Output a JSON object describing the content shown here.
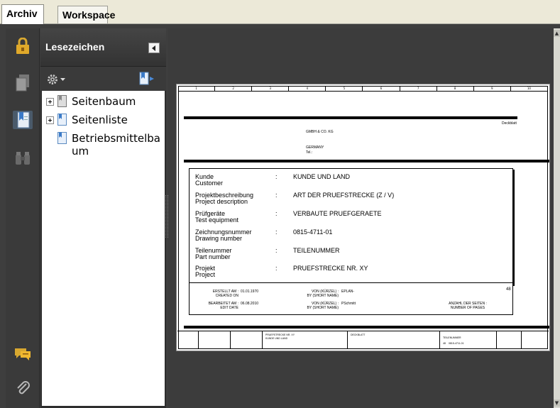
{
  "tabs": [
    {
      "label": "Archiv",
      "active": true
    },
    {
      "label": "Workspace",
      "active": false
    }
  ],
  "left_toolbar": {
    "icons": [
      "lock-icon",
      "pages-icon",
      "bookmarks-icon",
      "binoculars-icon",
      "comments-icon",
      "attachment-icon"
    ]
  },
  "bookmarks_panel": {
    "title": "Lesezeichen",
    "options_icon": "gear-icon",
    "new_bookmark_icon": "new-bookmark-icon",
    "items": [
      {
        "label": "Seitenbaum",
        "expandable": true
      },
      {
        "label": "Seitenliste",
        "expandable": true
      },
      {
        "label": "Betriebsmittelbaum",
        "label_line1": "Betriebsmittelba",
        "label_line2": "um",
        "expandable": false
      }
    ]
  },
  "document_page": {
    "header": {
      "company": "GMBH & CO. KG",
      "country": "GERMANY",
      "tel": "Tel.:",
      "right_note": "Deckblatt"
    },
    "fields": [
      {
        "label_de": "Kunde",
        "label_en": "Customer",
        "value": "KUNDE UND LAND"
      },
      {
        "label_de": "Projektbeschreibung",
        "label_en": "Project description",
        "value": "ART DER PRUEFSTRECKE (Z / V)"
      },
      {
        "label_de": "Prüfgeräte",
        "label_en": "Test equipment",
        "value": "VERBAUTE PRUEFGERAETE"
      },
      {
        "label_de": "Zeichnungsnummer",
        "label_en": "Drawing number",
        "value": "0815-4711-01"
      },
      {
        "label_de": "Teilenummer",
        "label_en": "Part number",
        "value": "TEILENUMMER"
      },
      {
        "label_de": "Projekt",
        "label_en": "Project",
        "value": "PRUEFSTRECKE NR. XY"
      }
    ],
    "colon": ":",
    "footer": {
      "created_label": "ERSTELLT AM :",
      "created_label_en": "CREATED ON",
      "created_value": "01.01.1970",
      "created_by_label": "VON (KÜRZEL) :",
      "created_by_label_en": "BY (SHORT NAME)",
      "created_by_value": "EPLAN-",
      "edited_label": "BEARBEITET AM :",
      "edited_label_en": "EDIT DATE",
      "edited_value": "06.08.2010",
      "edited_by_label": "VON (KÜRZEL) :",
      "edited_by_label_en": "BY (SHORT NAME)",
      "edited_by_value": "PSchmitt",
      "pages_label": "ANZAHL DER SEITEN :",
      "pages_label_en": "NUMBER OF PAGES",
      "pages_value": "48"
    },
    "title_block": {
      "line1": "PRUEFSTRECKE NR. XY",
      "line2": "KUNDE UND LAND",
      "sheet_type": "DECKBLATT",
      "part": "TEILENUMMER",
      "drawing": "0815-4711-01",
      "page_num": "48"
    },
    "ruler": [
      "1",
      "2",
      "3",
      "4",
      "5",
      "6",
      "7",
      "8",
      "9",
      "10"
    ]
  }
}
